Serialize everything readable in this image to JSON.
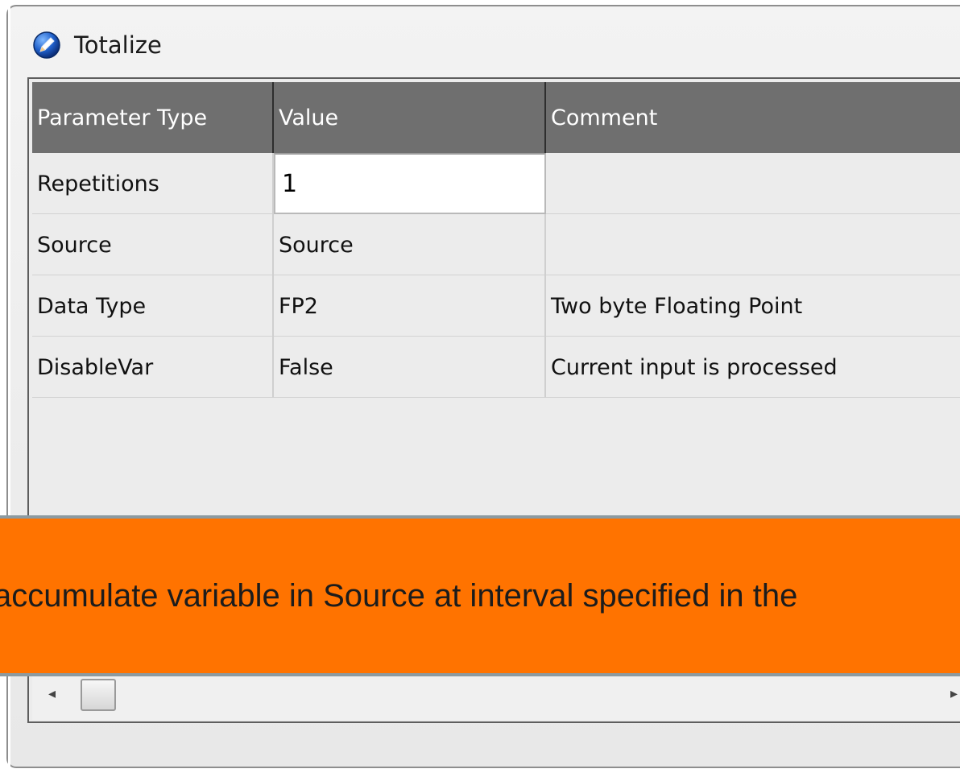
{
  "window": {
    "title": "Totalize",
    "icon": "pencil-icon"
  },
  "grid": {
    "columns": [
      "Parameter Type",
      "Value",
      "Comment"
    ],
    "rows": [
      {
        "param": "Repetitions",
        "value": "1",
        "comment": "",
        "editing": true
      },
      {
        "param": "Source",
        "value": "Source",
        "comment": ""
      },
      {
        "param": "Data Type",
        "value": "FP2",
        "comment": "Two byte Floating Point"
      },
      {
        "param": "DisableVar",
        "value": "False",
        "comment": "Current input is processed"
      }
    ]
  },
  "banner": {
    "text": "accumulate variable in Source at interval specified in the",
    "color": "#ff7300"
  },
  "colors": {
    "header_bg": "#6f6f6f",
    "grid_bg": "#ececec"
  }
}
